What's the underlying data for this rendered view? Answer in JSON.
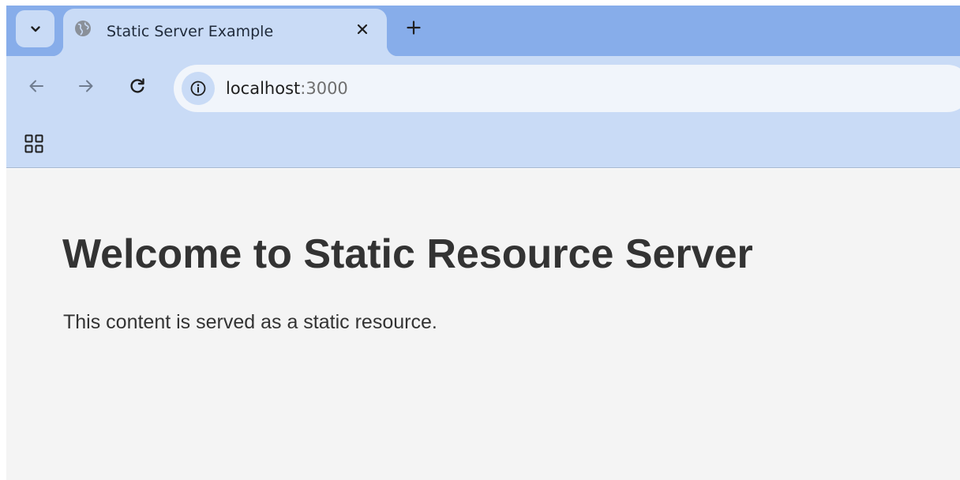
{
  "browser": {
    "tab": {
      "title": "Static Server Example"
    },
    "address": {
      "host": "localhost",
      "port": ":3000"
    }
  },
  "page": {
    "heading": "Welcome to Static Resource Server",
    "paragraph": "This content is served as a static resource."
  },
  "colors": {
    "tabstrip": "#87adea",
    "toolbar": "#c9dbf6",
    "omnibox": "#f1f5fb",
    "page_background": "#f4f4f4",
    "text": "#333333"
  },
  "icons": {
    "tab_search": "chevron-down-icon",
    "favicon": "globe-icon",
    "close": "close-icon",
    "new_tab": "plus-icon",
    "back": "arrow-left-icon",
    "forward": "arrow-right-icon",
    "reload": "reload-icon",
    "site_info": "info-icon",
    "apps": "apps-grid-icon"
  }
}
